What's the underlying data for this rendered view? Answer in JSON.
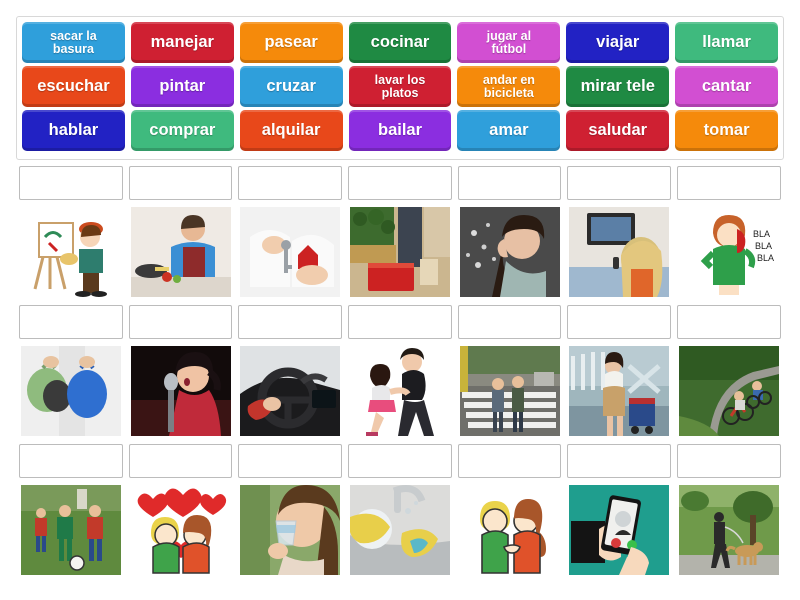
{
  "wordbank": {
    "rows": [
      [
        {
          "label": "sacar la\nbasura",
          "color": "#2f9fdb",
          "small": true
        },
        {
          "label": "manejar",
          "color": "#cf2032",
          "small": false
        },
        {
          "label": "pasear",
          "color": "#f58a0b",
          "small": false
        },
        {
          "label": "cocinar",
          "color": "#1f8a43",
          "small": false
        },
        {
          "label": "jugar al\nfútbol",
          "color": "#d24fd2",
          "small": true
        },
        {
          "label": "viajar",
          "color": "#2222c4",
          "small": false
        },
        {
          "label": "llamar",
          "color": "#3fba7e",
          "small": false
        }
      ],
      [
        {
          "label": "escuchar",
          "color": "#e8481a",
          "small": false
        },
        {
          "label": "pintar",
          "color": "#8b2ee0",
          "small": false
        },
        {
          "label": "cruzar",
          "color": "#2f9fdb",
          "small": false
        },
        {
          "label": "lavar los\nplatos",
          "color": "#cf2032",
          "small": true
        },
        {
          "label": "andar en\nbicicleta",
          "color": "#f58a0b",
          "small": true
        },
        {
          "label": "mirar tele",
          "color": "#1f8a43",
          "small": false
        },
        {
          "label": "cantar",
          "color": "#d24fd2",
          "small": false
        }
      ],
      [
        {
          "label": "hablar",
          "color": "#2222c4",
          "small": false
        },
        {
          "label": "comprar",
          "color": "#3fba7e",
          "small": false
        },
        {
          "label": "alquilar",
          "color": "#e8481a",
          "small": false
        },
        {
          "label": "bailar",
          "color": "#8b2ee0",
          "small": false
        },
        {
          "label": "amar",
          "color": "#2f9fdb",
          "small": false
        },
        {
          "label": "saludar",
          "color": "#cf2032",
          "small": false
        },
        {
          "label": "tomar",
          "color": "#f58a0b",
          "small": false
        }
      ]
    ]
  },
  "grid": {
    "dropzone_value": "",
    "rows": [
      [
        {
          "image": "boy-painting-at-easel-illustration"
        },
        {
          "image": "man-cooking-chopping-vegetables-photo"
        },
        {
          "image": "hands-holding-car-key-and-house-keychain-photo"
        },
        {
          "image": "person-with-red-shopping-basket-at-market-photo"
        },
        {
          "image": "woman-cupping-ear-listening-photo"
        },
        {
          "image": "woman-watching-tv-with-remote-photo"
        },
        {
          "image": "girl-talking-on-phone-bla-bla-illustration"
        }
      ],
      [
        {
          "image": "person-carrying-garbage-bags-photo"
        },
        {
          "image": "woman-singing-into-microphone-photo"
        },
        {
          "image": "hands-driving-car-steering-wheel-photo"
        },
        {
          "image": "couple-dancing-photo"
        },
        {
          "image": "people-crossing-crosswalk-photo"
        },
        {
          "image": "woman-with-luggage-travelling-photo"
        },
        {
          "image": "family-riding-bicycles-on-path-photo"
        }
      ],
      [
        {
          "image": "men-playing-soccer-photo"
        },
        {
          "image": "boy-and-girl-in-love-hearts-illustration"
        },
        {
          "image": "woman-drinking-glass-of-water-photo"
        },
        {
          "image": "gloved-hands-washing-dishes-in-sink-photo"
        },
        {
          "image": "boy-and-girl-shaking-hands-illustration"
        },
        {
          "image": "hands-holding-phone-incoming-call-illustration"
        },
        {
          "image": "man-walking-dog-in-park-photo"
        }
      ]
    ]
  }
}
